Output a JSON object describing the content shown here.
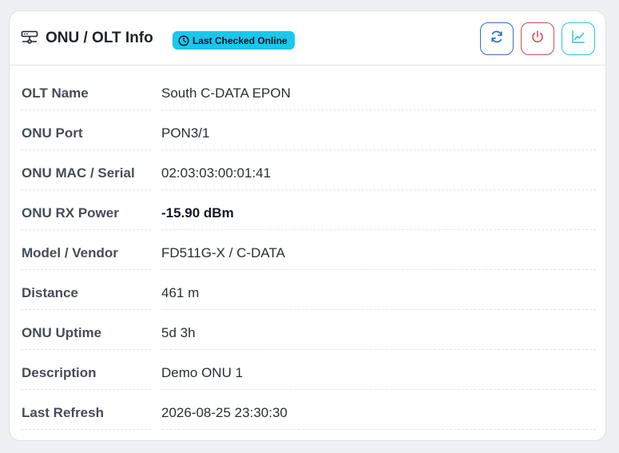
{
  "header": {
    "title": "ONU / OLT Info",
    "status_badge": "Last Checked Online",
    "icons": {
      "title_icon": "network-device-icon",
      "badge_icon": "clock-icon",
      "refresh": "refresh-icon",
      "power": "power-icon",
      "graph": "line-chart-icon"
    }
  },
  "colors": {
    "badge": "#19c8ec",
    "refresh_button": "#2f6fd0",
    "power_button": "#d04a55",
    "graph_button": "#2cc6d8"
  },
  "rows": [
    {
      "label": "OLT Name",
      "value": "South C-DATA EPON"
    },
    {
      "label": "ONU Port",
      "value": "PON3/1"
    },
    {
      "label": "ONU MAC / Serial",
      "value": "02:03:03:00:01:41"
    },
    {
      "label": "ONU RX Power",
      "value": "-15.90 dBm"
    },
    {
      "label": "Model / Vendor",
      "value": "FD511G-X / C-DATA"
    },
    {
      "label": "Distance",
      "value": "461 m"
    },
    {
      "label": "ONU Uptime",
      "value": "5d 3h"
    },
    {
      "label": "Description",
      "value": "Demo ONU 1"
    },
    {
      "label": "Last Refresh",
      "value": "2026-08-25 23:30:30"
    }
  ]
}
